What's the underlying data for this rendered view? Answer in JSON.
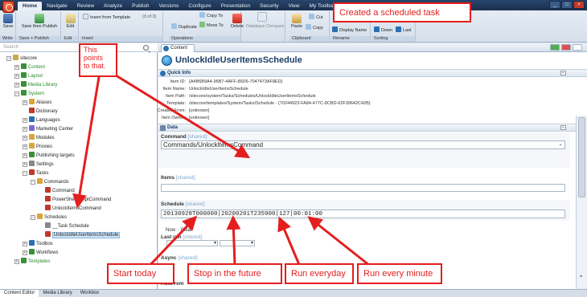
{
  "ribbon": {
    "tabs": [
      "Home",
      "Navigate",
      "Review",
      "Analyze",
      "Publish",
      "Versions",
      "Configure",
      "Presentation",
      "Security",
      "View",
      "My Toolbar"
    ],
    "active_tab": "Home",
    "save": "Save",
    "save_then_publish": "Save then Publish",
    "edit": "Edit",
    "insert_from_template": "Insert from Template",
    "counter": "(3 of 3)",
    "copy_to": "Copy To",
    "move_to": "Move To",
    "duplicate": "Duplicate",
    "delete": "Delete",
    "database_compare": "Database Compare",
    "paste": "Paste",
    "cut": "Cut",
    "copy": "Copy",
    "display_name": "Display Name",
    "down": "Down",
    "last": "Last",
    "groups": {
      "write": "Write",
      "save_publish": "Save + Publish",
      "edit": "Edit",
      "insert": "Insert",
      "operations": "Operations",
      "clipboard": "Clipboard",
      "rename": "Rename",
      "sorting": "Sorting"
    }
  },
  "search": {
    "placeholder": "Search"
  },
  "tree": [
    {
      "label": "sitecore",
      "depth": 0,
      "exp": "−",
      "color": "#c9a84a"
    },
    {
      "label": "Content",
      "depth": 1,
      "exp": "+",
      "color": "#3b8f3b",
      "green": true
    },
    {
      "label": "Layout",
      "depth": 1,
      "exp": "+",
      "color": "#3b8f3b",
      "green": true
    },
    {
      "label": "Media Library",
      "depth": 1,
      "exp": "+",
      "color": "#3b8f3b",
      "green": true
    },
    {
      "label": "System",
      "depth": 1,
      "exp": "−",
      "color": "#3b8f3b",
      "green": true
    },
    {
      "label": "Aliases",
      "depth": 2,
      "exp": "+",
      "color": "#d9a63a"
    },
    {
      "label": "Dictionary",
      "depth": 2,
      "exp": "",
      "color": "#c0392b"
    },
    {
      "label": "Languages",
      "depth": 2,
      "exp": "+",
      "color": "#2a6fb4"
    },
    {
      "label": "Marketing Center",
      "depth": 2,
      "exp": "+",
      "color": "#7a6ad0"
    },
    {
      "label": "Modules",
      "depth": 2,
      "exp": "+",
      "color": "#d9a63a"
    },
    {
      "label": "Proxies",
      "depth": 2,
      "exp": "+",
      "color": "#d9a63a"
    },
    {
      "label": "Publishing targets",
      "depth": 2,
      "exp": "+",
      "color": "#3b8f3b"
    },
    {
      "label": "Settings",
      "depth": 2,
      "exp": "+",
      "color": "#888888"
    },
    {
      "label": "Tasks",
      "depth": 2,
      "exp": "−",
      "color": "#c0392b"
    },
    {
      "label": "Commands",
      "depth": 3,
      "exp": "−",
      "color": "#d9a63a"
    },
    {
      "label": "Command",
      "depth": 4,
      "exp": "",
      "color": "#c0392b"
    },
    {
      "label": "PowerShellScriptCommand",
      "depth": 4,
      "exp": "",
      "color": "#c0392b"
    },
    {
      "label": "UnlockItemsCommand",
      "depth": 4,
      "exp": "",
      "color": "#c0392b"
    },
    {
      "label": "Schedules",
      "depth": 3,
      "exp": "−",
      "color": "#d9a63a"
    },
    {
      "label": "__Task Schedule",
      "depth": 4,
      "exp": "",
      "color": "#888888"
    },
    {
      "label": "UnlockIdleUserItemsSchedule",
      "depth": 4,
      "exp": "",
      "color": "#c0392b",
      "selected": true
    },
    {
      "label": "Toolbox",
      "depth": 2,
      "exp": "+",
      "color": "#2a6fb4"
    },
    {
      "label": "Workflows",
      "depth": 2,
      "exp": "+",
      "color": "#3b8f3b"
    },
    {
      "label": "Templates",
      "depth": 1,
      "exp": "+",
      "color": "#3b8f3b",
      "green": true
    }
  ],
  "content": {
    "tab_label": "Content",
    "item_title": "UnlockIdleUserItemsSchedule",
    "quick_info": {
      "section_label": "Quick Info",
      "rows": [
        {
          "label": "Item ID:",
          "value": "{A4B6B9A4-95B7-4AFF-86D6-7047473AF8ED}"
        },
        {
          "label": "Item Name:",
          "value": "UnlockIdleUserItemsSchedule"
        },
        {
          "label": "Item Path:",
          "value": "/sitecore/system/Tasks/Schedules/UnlockIdleUserItemsSchedule"
        },
        {
          "label": "Template:",
          "value": "/sitecore/templates/System/Tasks/Schedule - {70244923-FA84-477C-8CBD-62F39642C42B}"
        },
        {
          "label": "Created From:",
          "value": "[unknown]"
        },
        {
          "label": "Item Owner:",
          "value": "[unknown]"
        }
      ]
    },
    "data": {
      "section_label": "Data",
      "command_label": "Command",
      "command_shared": "[shared]:",
      "command_value": "Commands/UnlockItemsCommand",
      "items_label": "Items",
      "items_shared": "[shared]:",
      "schedule_label": "Schedule",
      "schedule_shared": "[shared]:",
      "schedule_value": "20130928T000000|20200201T235900|127|00:01:00",
      "now_link": "Now",
      "clear_link": "Clear",
      "last_run_label": "Last run",
      "last_run_shared": "[shared]:",
      "async_label": "Async",
      "async_shared": "[shared]:",
      "remove_label": "Auto rem"
    }
  },
  "bottom_tabs": [
    "Content Editor",
    "Media Library",
    "Workbox"
  ],
  "annotations": {
    "top_callout": "Created a scheduled task",
    "points_line1": "This",
    "points_line2": "points",
    "points_line3": "to that.",
    "start_today": "Start today",
    "stop_future": "Stop in the future",
    "run_everyday": "Run everyday",
    "run_every_minute": "Run every minute",
    "color": "#e41e1e"
  }
}
